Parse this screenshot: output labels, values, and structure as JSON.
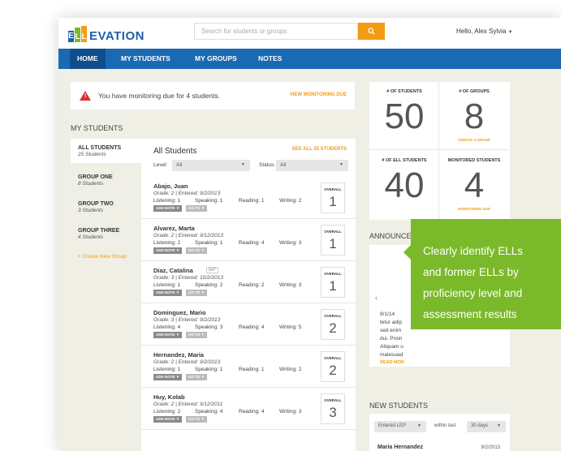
{
  "brand": {
    "logo_text": "EVATION",
    "logo_letters": [
      "E",
      "L",
      "L"
    ],
    "colors": {
      "nav": "#1a6ab3",
      "accent": "#f39c12",
      "callout": "#7ab92a",
      "alert": "#d9312b"
    }
  },
  "header": {
    "search_placeholder": "Search for students or groups",
    "search_icon": "search-icon",
    "greeting": "Hello, Alex Sylvia"
  },
  "nav": {
    "items": [
      "HOME",
      "MY STUDENTS",
      "MY GROUPS",
      "NOTES"
    ]
  },
  "alert": {
    "message": "You have monitoring due for 4 students.",
    "link": "VIEW MONITORING DUE"
  },
  "my_students": {
    "title": "MY STUDENTS",
    "groups": [
      {
        "name": "ALL STUDENTS",
        "count": "25 Students"
      },
      {
        "name": "GROUP ONE",
        "count": "8 Students"
      },
      {
        "name": "GROUP TWO",
        "count": "3 Students"
      },
      {
        "name": "GROUP THREE",
        "count": "4 Students"
      }
    ],
    "create_group": "+ Create New Group"
  },
  "list": {
    "title": "All Students",
    "see_all": "SEE ALL 25 STUDENTS",
    "level_label": "Level:",
    "level_value": "All",
    "status_label": "Status:",
    "status_value": "All",
    "overall_label": "OVERALL",
    "add_note": "ADD NOTE",
    "goto": "GO TO",
    "students": [
      {
        "name": "Abajo, Juan",
        "iep": "",
        "grade": "Grade: 2  |  Entered: 9/2/2013",
        "listening": "Listening: 1",
        "speaking": "Speaking: 1",
        "reading": "Reading: 1",
        "writing": "Writing: 2",
        "overall": "1"
      },
      {
        "name": "Alvarez, Marta",
        "iep": "",
        "grade": "Grade: 2  |  Entered: 9/12/2013",
        "listening": "Listening: 2",
        "speaking": "Speaking: 1",
        "reading": "Reading: 4",
        "writing": "Writing: 3",
        "overall": "1"
      },
      {
        "name": "Diaz, Catalina",
        "iep": "IEP",
        "grade": "Grade: 3  |  Entered: 10/2/2013",
        "listening": "Listening: 1",
        "speaking": "Speaking: 2",
        "reading": "Reading: 2",
        "writing": "Writing: 3",
        "overall": "1"
      },
      {
        "name": "Dominguez, Mario",
        "iep": "",
        "grade": "Grade: 3  |  Entered: 9/2/2013",
        "listening": "Listening: 4",
        "speaking": "Speaking: 3",
        "reading": "Reading: 4",
        "writing": "Writing: 5",
        "overall": "2"
      },
      {
        "name": "Hernandez, Maria",
        "iep": "",
        "grade": "Grade: 2  |  Entered: 9/2/2013",
        "listening": "Listening: 1",
        "speaking": "Speaking: 1",
        "reading": "Reading: 1",
        "writing": "Writing: 2",
        "overall": "2"
      },
      {
        "name": "Huy, Kolab",
        "iep": "",
        "grade": "Grade: 2  |  Entered: 9/12/2011",
        "listening": "Listening: 2",
        "speaking": "Speaking: 4",
        "reading": "Reading: 4",
        "writing": "Writing: 3",
        "overall": "3"
      }
    ]
  },
  "stats": [
    {
      "label": "# OF STUDENTS",
      "value": "50",
      "link": ""
    },
    {
      "label": "# OF GROUPS",
      "value": "8",
      "link": "CREATE A GROUP"
    },
    {
      "label": "# OF ELL STUDENTS",
      "value": "40",
      "link": ""
    },
    {
      "label": "MONITORED STUDENTS",
      "value": "4",
      "link": "MONITORING DUE"
    }
  ],
  "announcements": {
    "title": "ANNOUNCEM",
    "lines": [
      "9/1/14",
      "tetur adip",
      "sed enim",
      "dui. Proin",
      "Aliquam u",
      "malesuad",
      "READ MOR"
    ]
  },
  "new_students": {
    "title": "NEW STUDENTS",
    "filter": "Entered LEP",
    "within": "within last",
    "range": "30 days",
    "first_name": "Maria Hernandez",
    "first_date": "9/2/2013"
  },
  "callout": {
    "lines": [
      "Clearly identify ELLs",
      "and former ELLs by",
      "proficiency level and",
      "assessment results"
    ]
  }
}
